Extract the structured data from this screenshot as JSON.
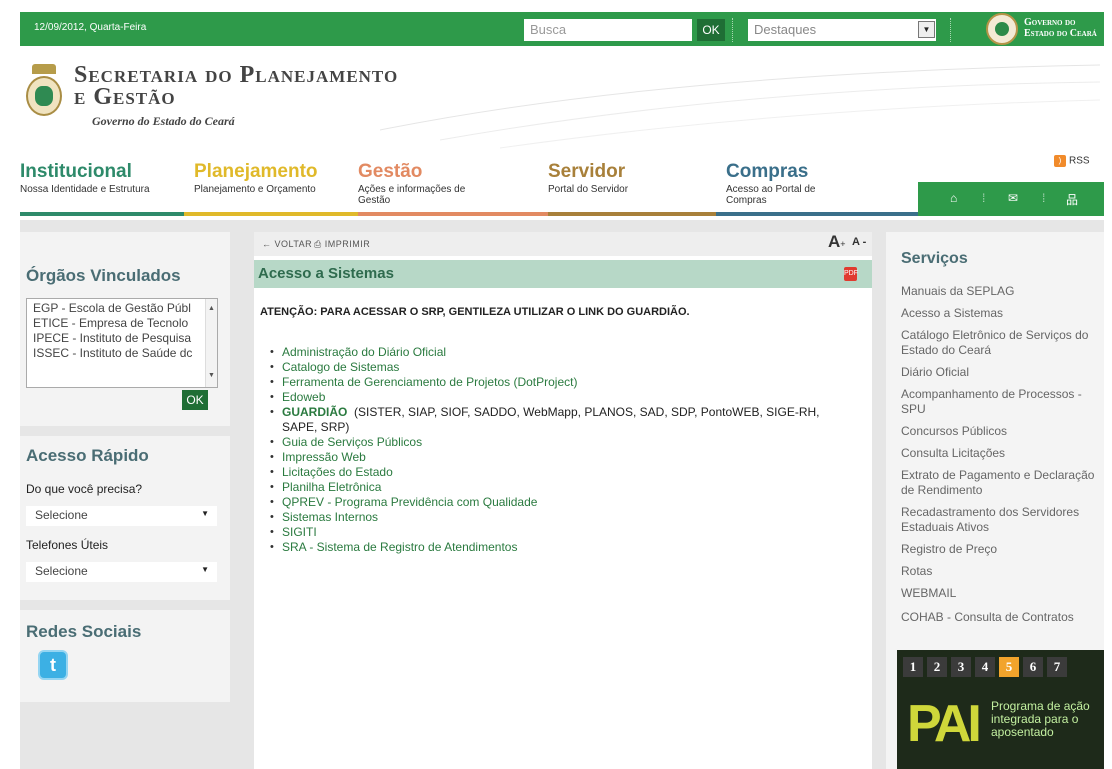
{
  "topbar": {
    "date": "12/09/2012, Quarta-Feira",
    "search_placeholder": "Busca",
    "ok": "OK",
    "destaques": "Destaques",
    "gov_line1": "Governo do",
    "gov_line2": "Estado do Ceará"
  },
  "brand": {
    "title_line1": "Secretaria do Planejamento",
    "title_line2": "e Gestão",
    "subtitle": "Governo do Estado do Ceará"
  },
  "nav": [
    {
      "title": "Institucional",
      "sub": "Nossa Identidade e Estrutura",
      "color": "#2e8a6a"
    },
    {
      "title": "Planejamento",
      "sub": "Planejamento e Orçamento",
      "color": "#e0b92a"
    },
    {
      "title": "Gestão",
      "sub": "Ações e informações de Gestão",
      "color": "#e28a62"
    },
    {
      "title": "Servidor",
      "sub": "Portal do Servidor",
      "color": "#a8803a"
    },
    {
      "title": "Compras",
      "sub": "Acesso ao Portal de Compras",
      "color": "#3a6f8a"
    }
  ],
  "rss": "RSS",
  "nav_icons": [
    "home-icon",
    "mail-icon",
    "sitemap-icon"
  ],
  "orgaos": {
    "title": "Órgãos Vinculados",
    "items": [
      "EGP - Escola de Gestão Públ",
      "ETICE - Empresa de Tecnolo",
      "IPECE - Instituto de Pesquisa",
      "ISSEC - Instituto de Saúde dc"
    ],
    "ok": "OK"
  },
  "acesso": {
    "title": "Acesso Rápido",
    "label1": "Do que você precisa?",
    "select1": "Selecione",
    "label2": "Telefones Úteis",
    "select2": "Selecione"
  },
  "redes": {
    "title": "Redes Sociais"
  },
  "toolbar": {
    "voltar": "← VOLTAR",
    "imprimir": "IMPRIMIR",
    "aplus": "A",
    "aminus": "A -"
  },
  "content": {
    "title": "Acesso a Sistemas",
    "atencao": "ATENÇÃO: PARA ACESSAR O SRP, GENTILEZA UTILIZAR O LINK DO GUARDIÃO.",
    "links": [
      "Administração do Diário Oficial",
      "Catalogo de Sistemas",
      "Ferramenta de Gerenciamento de Projetos (DotProject)",
      "Edoweb",
      "GUARDIÃO",
      "Guia de Serviços Públicos",
      "Impressão Web",
      "Licitações do Estado",
      "Planilha Eletrônica",
      "QPREV - Programa Previdência com Qualidade",
      "Sistemas Internos",
      "SIGITI",
      "SRA - Sistema de Registro de Atendimentos"
    ],
    "guardiao_systems": "(SISTER, SIAP, SIOF, SADDO, WebMapp, PLANOS, SAD, SDP, PontoWEB, SIGE-RH, SAPE, SRP)"
  },
  "servicos": {
    "title": "Serviços",
    "items": [
      "Manuais da SEPLAG",
      "Acesso a Sistemas",
      "Catálogo Eletrônico de Serviços do Estado do Ceará",
      "Diário Oficial",
      "Acompanhamento de Processos - SPU",
      "Concursos Públicos",
      "Consulta Licitações",
      "Extrato de Pagamento e Declaração de Rendimento",
      "Recadastramento dos Servidores Estaduais Ativos",
      "Registro de Preço",
      "Rotas",
      "WEBMAIL",
      "COHAB - Consulta de Contratos"
    ]
  },
  "promo": {
    "pages": [
      "1",
      "2",
      "3",
      "4",
      "5",
      "6",
      "7"
    ],
    "active_page": "5",
    "logo": "PAI",
    "text": "Programa de ação integrada para o aposentado"
  }
}
